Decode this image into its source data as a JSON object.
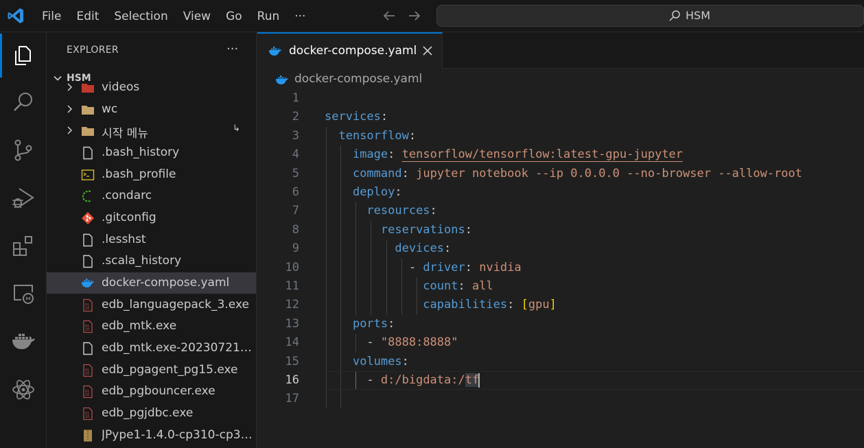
{
  "menu": [
    "File",
    "Edit",
    "Selection",
    "View",
    "Go",
    "Run",
    "···"
  ],
  "search": {
    "text": "HSM"
  },
  "sidebar": {
    "title": "EXPLORER",
    "more": "···",
    "folder": "HSM",
    "items": [
      {
        "label": "videos",
        "type": "folder-red"
      },
      {
        "label": "wc",
        "type": "folder"
      },
      {
        "label": "시작 메뉴",
        "type": "folder",
        "decoration": "↳"
      },
      {
        "label": ".bash_history",
        "type": "file"
      },
      {
        "label": ".bash_profile",
        "type": "terminal"
      },
      {
        "label": ".condarc",
        "type": "conda"
      },
      {
        "label": ".gitconfig",
        "type": "git"
      },
      {
        "label": ".lesshst",
        "type": "file"
      },
      {
        "label": ".scala_history",
        "type": "file"
      },
      {
        "label": "docker-compose.yaml",
        "type": "docker",
        "selected": true
      },
      {
        "label": "edb_languagepack_3.exe",
        "type": "binary"
      },
      {
        "label": "edb_mtk.exe",
        "type": "binary"
      },
      {
        "label": "edb_mtk.exe-202307212...",
        "type": "file"
      },
      {
        "label": "edb_pgagent_pg15.exe",
        "type": "binary"
      },
      {
        "label": "edb_pgbouncer.exe",
        "type": "binary"
      },
      {
        "label": "edb_pgjdbc.exe",
        "type": "binary"
      },
      {
        "label": "JPype1-1.4.0-cp310-cp31...",
        "type": "archive"
      }
    ]
  },
  "tab": {
    "label": "docker-compose.yaml",
    "close": "✕"
  },
  "breadcrumb": {
    "label": "docker-compose.yaml"
  },
  "editor": {
    "current_line": 16,
    "lines": [
      {
        "n": "1"
      },
      {
        "n": "2"
      },
      {
        "n": "3"
      },
      {
        "n": "4"
      },
      {
        "n": "5"
      },
      {
        "n": "6"
      },
      {
        "n": "7"
      },
      {
        "n": "8"
      },
      {
        "n": "9"
      },
      {
        "n": "10"
      },
      {
        "n": "11"
      },
      {
        "n": "12"
      },
      {
        "n": "13"
      },
      {
        "n": "14"
      },
      {
        "n": "15"
      },
      {
        "n": "16"
      },
      {
        "n": "17"
      }
    ],
    "tokens": {
      "services": "services",
      "tensorflow": "tensorflow",
      "image": "image",
      "image_val": "tensorflow/tensorflow:latest-gpu-jupyter",
      "command": "command",
      "command_val": "jupyter notebook --ip 0.0.0.0 --no-browser --allow-root",
      "deploy": "deploy",
      "resources": "resources",
      "reservations": "reservations",
      "devices": "devices",
      "driver": "driver",
      "driver_val": "nvidia",
      "count": "count",
      "count_val": "all",
      "capabilities": "capabilities",
      "gpu": "gpu",
      "ports": "ports",
      "port_val": "\"8888:8888\"",
      "volumes": "volumes",
      "volume_val_a": "d:/bigdata:/",
      "volume_val_b": "tf"
    }
  },
  "colors": {
    "accent": "#0078d4",
    "keyword": "#569cd6",
    "string": "#ce9178",
    "bracket": "#ffd700"
  }
}
